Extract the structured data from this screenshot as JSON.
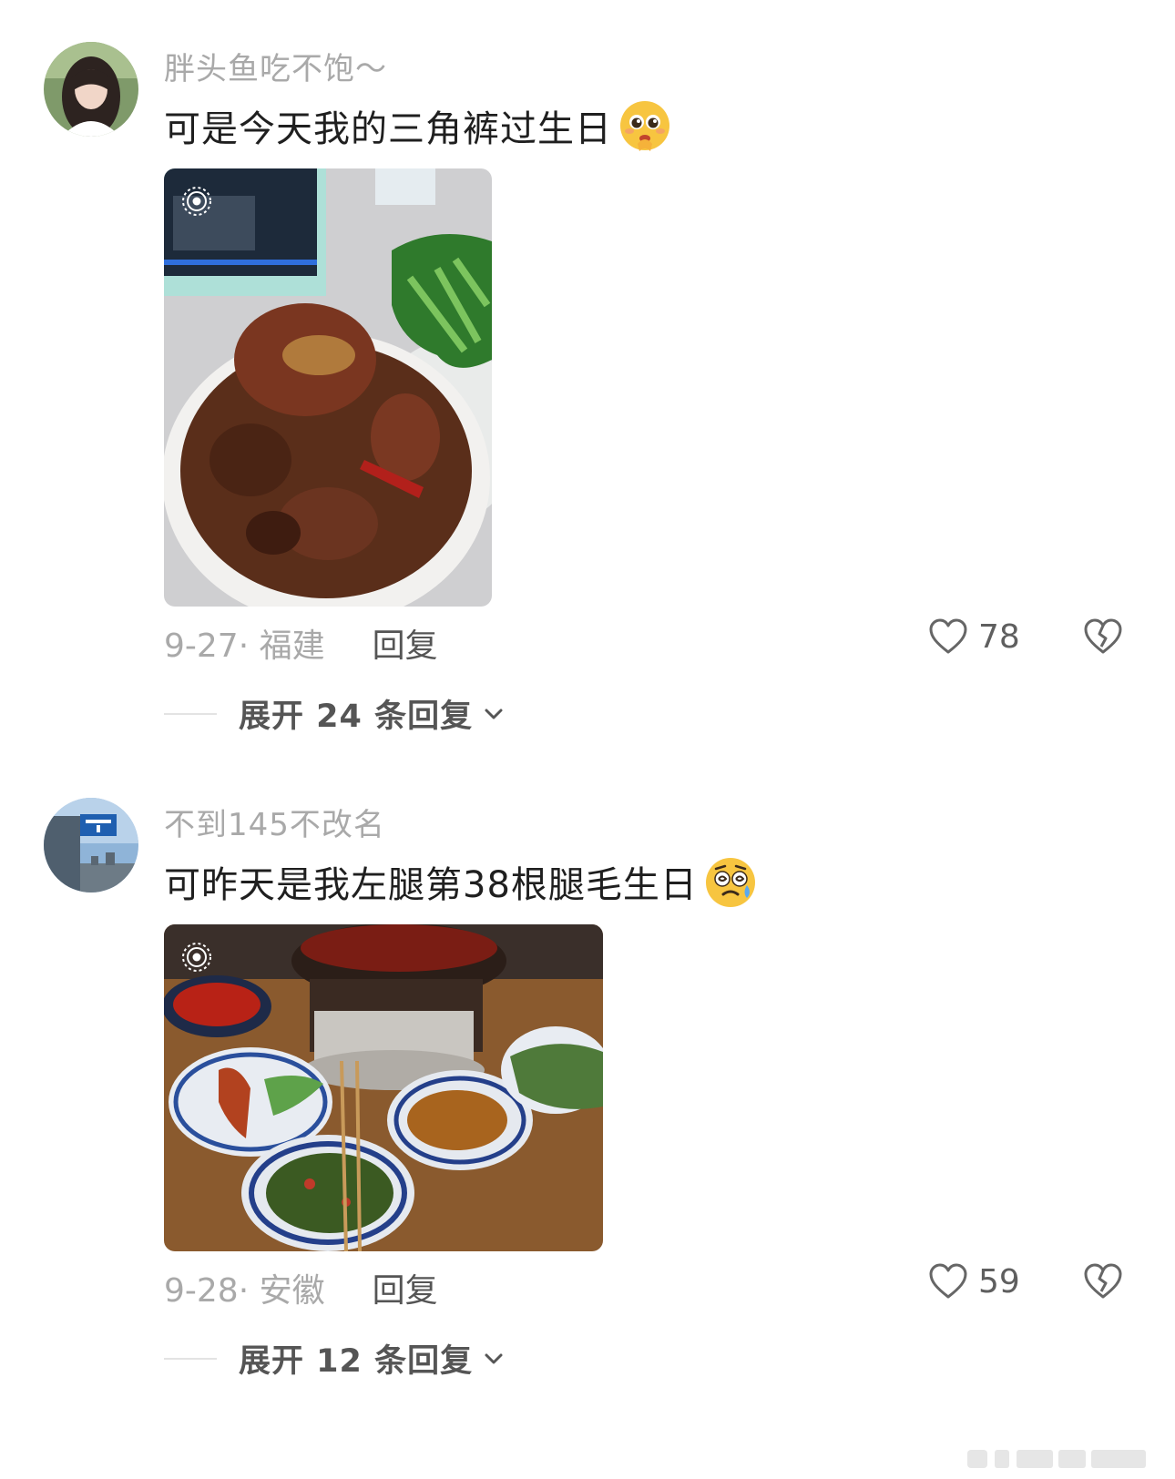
{
  "comments": [
    {
      "username": "胖头鱼吃不饱～",
      "text": "可是今天我的三角裤过生日",
      "emoji": "pleading-face-emoji",
      "date_location": "9-27· 福建",
      "reply_label": "回复",
      "likes": "78",
      "expand_label": "展开 24 条回复"
    },
    {
      "username": "不到145不改名",
      "text": "可昨天是我左腿第38根腿毛生日",
      "emoji": "dizzy-sweat-face-emoji",
      "date_location": "9-28· 安徽",
      "reply_label": "回复",
      "likes": "59",
      "expand_label": "展开 12 条回复"
    }
  ],
  "icons": {
    "like": "heart-outline-icon",
    "dislike": "broken-heart-icon",
    "expand": "chevron-down-icon",
    "live_photo": "live-photo-icon"
  },
  "colors": {
    "username": "#a9a9a9",
    "text": "#1f1f1f",
    "secondary": "#555555"
  }
}
